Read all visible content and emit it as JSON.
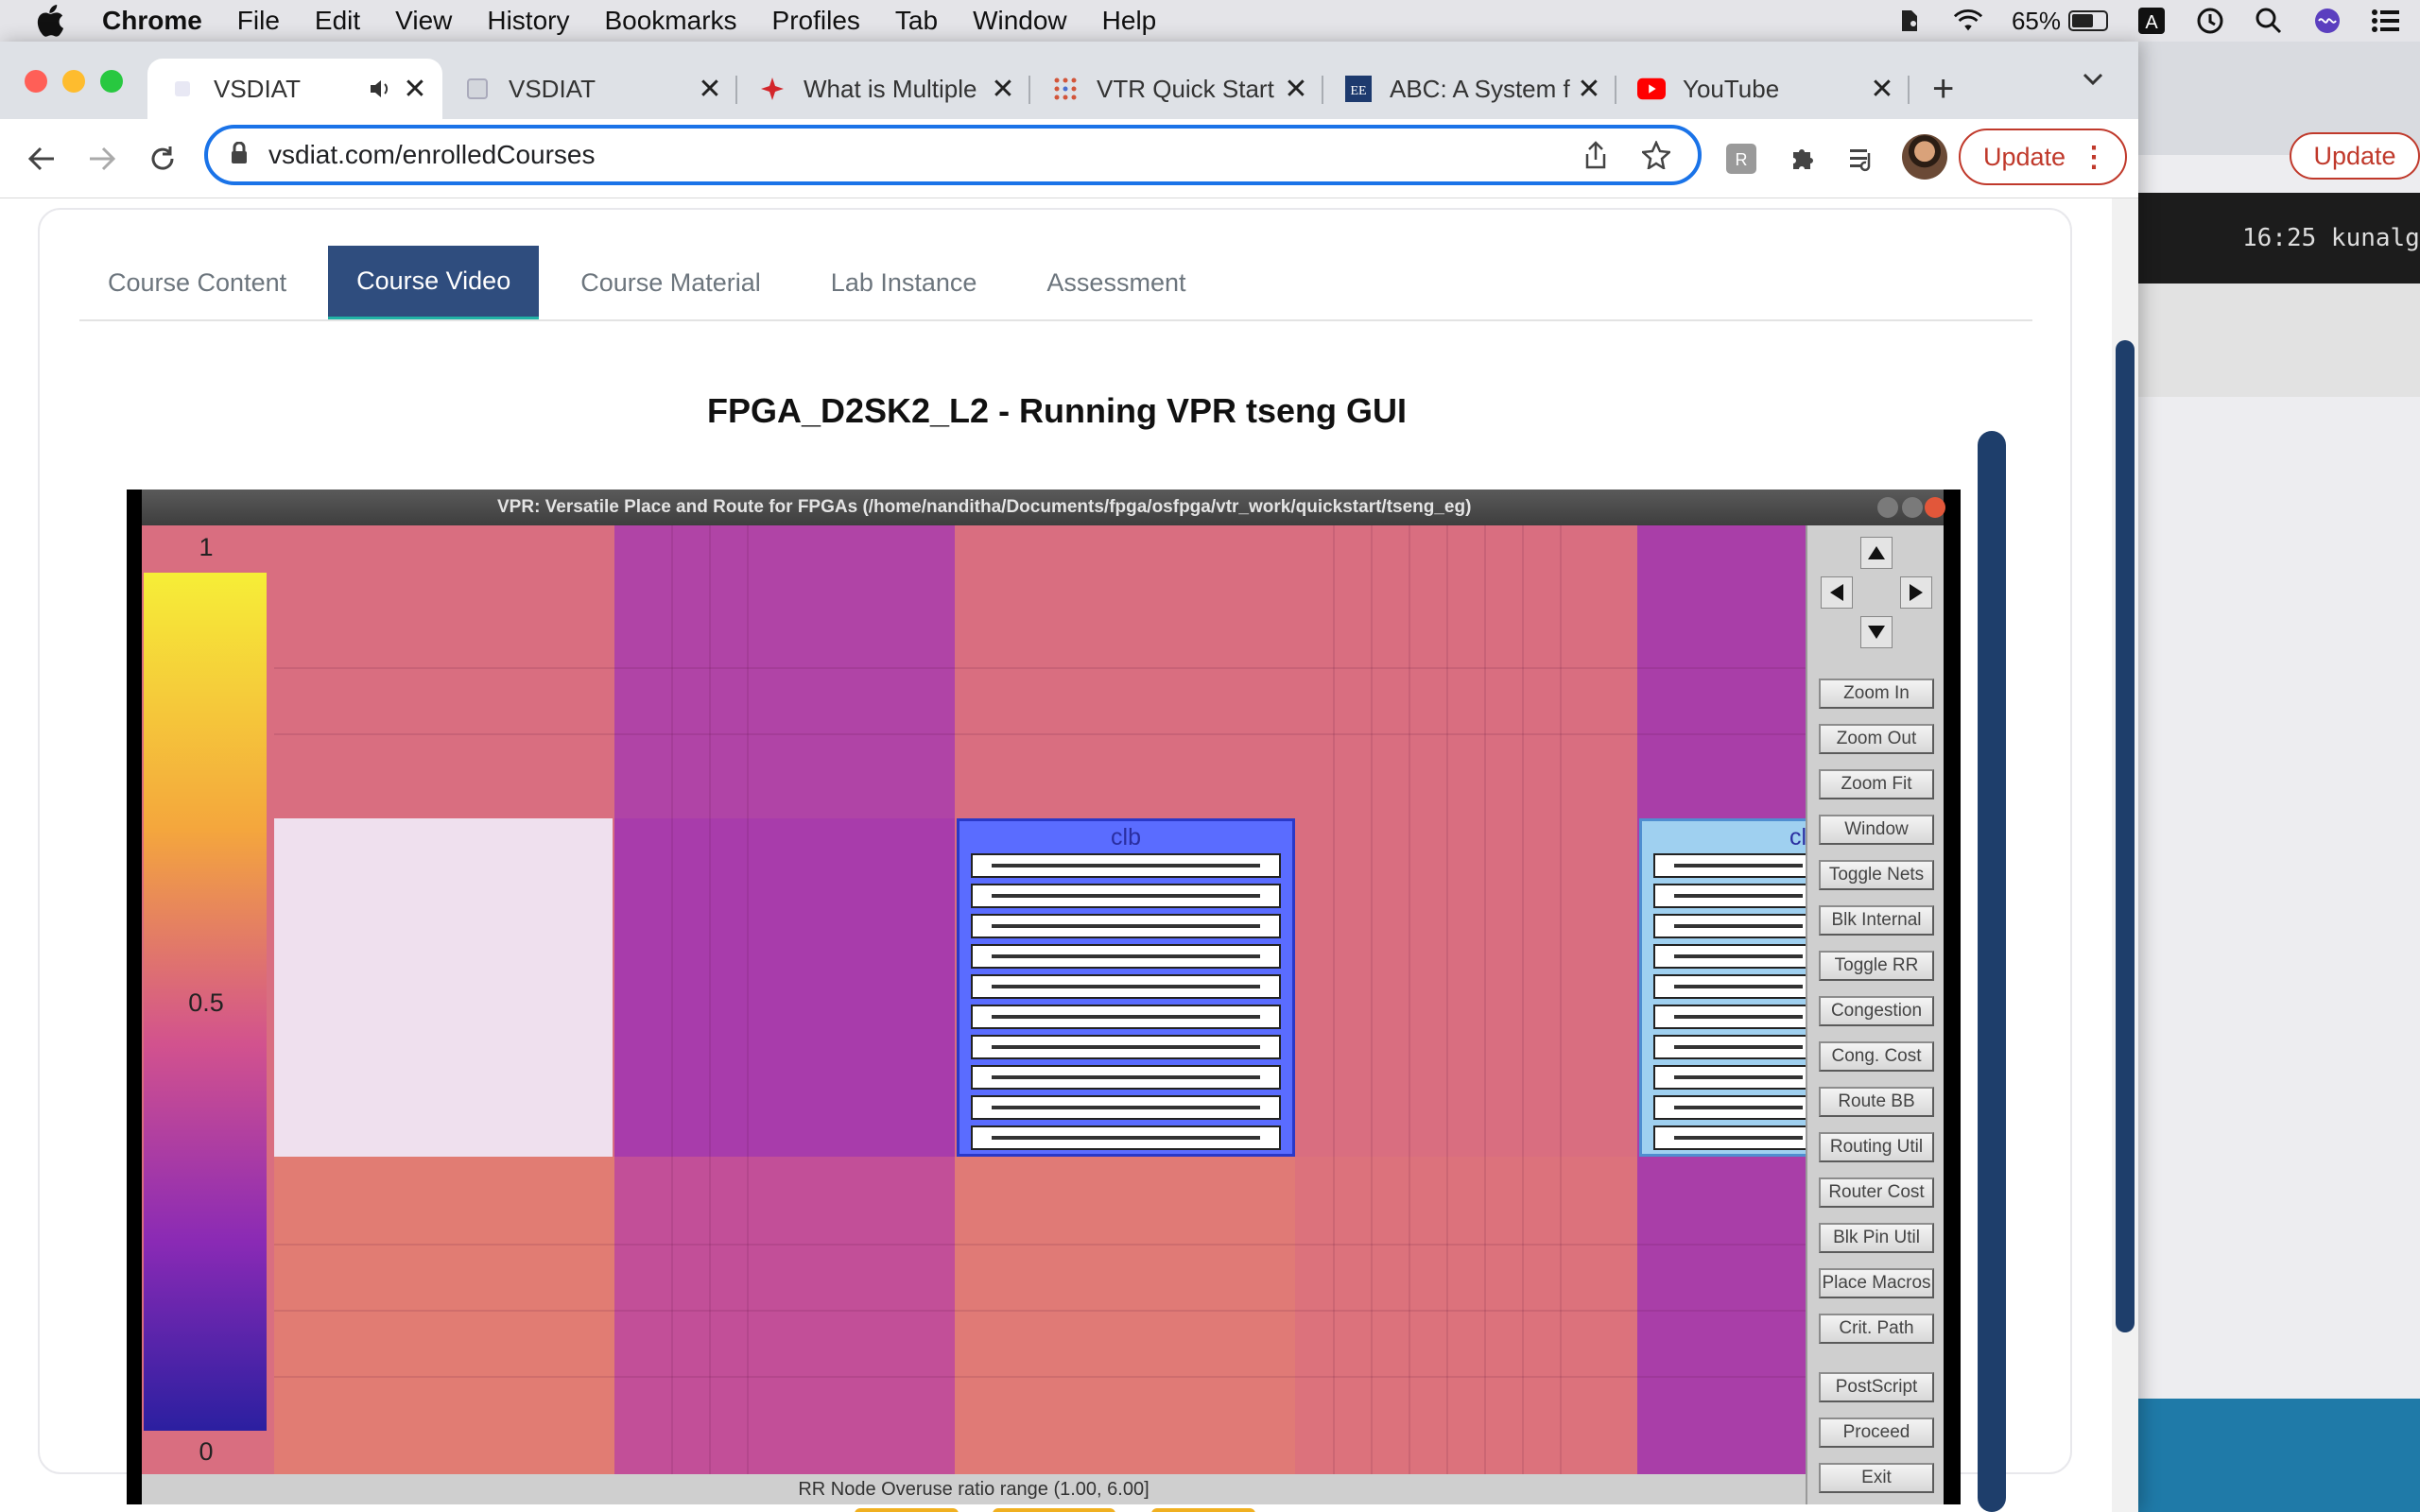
{
  "menubar": {
    "app": "Chrome",
    "items": [
      "File",
      "Edit",
      "View",
      "History",
      "Bookmarks",
      "Profiles",
      "Tab",
      "Window",
      "Help"
    ],
    "battery": "65%"
  },
  "tabs": [
    {
      "title": "VSDIAT",
      "active": true
    },
    {
      "title": "VSDIAT",
      "active": false
    },
    {
      "title": "What is Multiple",
      "active": false
    },
    {
      "title": "VTR Quick Start",
      "active": false
    },
    {
      "title": "ABC: A System f",
      "active": false
    },
    {
      "title": "YouTube",
      "active": false
    }
  ],
  "omnibox": {
    "host": "vsdiat.com",
    "path": "/enrolledCourses"
  },
  "toolbar": {
    "update_label": "Update"
  },
  "background_window": {
    "update_label": "Update",
    "terminal_text": "16:25  kunalg"
  },
  "course_tabs": [
    {
      "label": "Course Content",
      "active": false
    },
    {
      "label": "Course Video",
      "active": true
    },
    {
      "label": "Course Material",
      "active": false
    },
    {
      "label": "Lab Instance",
      "active": false
    },
    {
      "label": "Assessment",
      "active": false
    }
  ],
  "video": {
    "title": "FPGA_D2SK2_L2 - Running VPR tseng GUI",
    "window_title": "VPR: Versatile Place and Route for FPGAs (/home/nanditha/Documents/fpga/osfpga/vtr_work/quickstart/tseng_eg)",
    "status_text": "RR Node Overuse ratio range (1.00, 6.00]",
    "legend": {
      "top": "1",
      "mid": "0.5",
      "bottom": "0"
    },
    "clb_label": "clb",
    "clb_label_partial": "cl",
    "buttons": [
      "Zoom In",
      "Zoom Out",
      "Zoom Fit",
      "Window",
      "Toggle Nets",
      "Blk Internal",
      "Toggle RR",
      "Congestion",
      "Cong. Cost",
      "Route BB",
      "Routing Util",
      "Router Cost",
      "Blk Pin Util",
      "Place Macros",
      "Crit. Path",
      "PostScript",
      "Proceed",
      "Exit"
    ]
  },
  "colors": {
    "accent": "#2f4d7e",
    "chrome_focus": "#1a73e8",
    "update": "#c0392b",
    "clb_blue": "#5a6cff"
  }
}
